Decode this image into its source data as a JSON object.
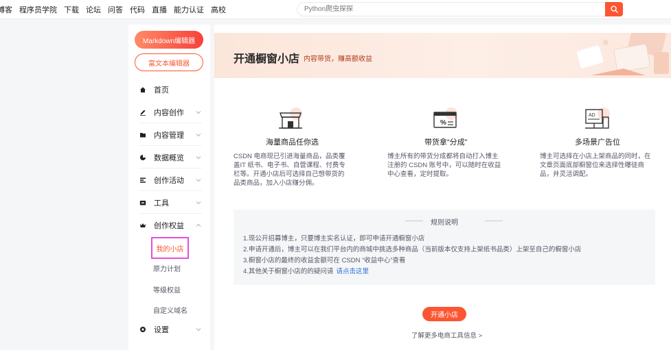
{
  "nav": {
    "items": [
      "博客",
      "程序员学院",
      "下载",
      "论坛",
      "问答",
      "代码",
      "直播",
      "能力认证",
      "高校"
    ]
  },
  "search": {
    "placeholder": "Python爬虫探探"
  },
  "sidebar": {
    "markdown_btn": "Markdown编辑器",
    "richtext_btn": "富文本编辑器",
    "items": [
      {
        "label": "首页",
        "icon": "home-icon"
      },
      {
        "label": "内容创作",
        "icon": "pen-icon"
      },
      {
        "label": "内容管理",
        "icon": "folder-icon"
      },
      {
        "label": "数据概览",
        "icon": "pie-chart-icon"
      },
      {
        "label": "创作活动",
        "icon": "list-icon"
      },
      {
        "label": "工具",
        "icon": "toolbox-icon"
      },
      {
        "label": "创作权益",
        "icon": "crown-icon"
      },
      {
        "label": "设置",
        "icon": "gear-icon"
      }
    ],
    "sub_items": [
      "我的小店",
      "原力计划",
      "等级权益",
      "自定义域名"
    ]
  },
  "banner": {
    "title": "开通橱窗小店",
    "subtitle": "内容带货，赚高额收益"
  },
  "features": [
    {
      "title": "海量商品任你选",
      "desc": "CSDN 电商现已引进海量商品，品类覆盖IT 纸书、电子书、自营课程、付费专栏等。开通小店后可选择自己想带货的品类商品，加入小店赚分佣。",
      "icon": "storefront-icon"
    },
    {
      "title": "带货拿“分成”",
      "desc": "博主所有的带货分成都将自动打入博主注册的 CSDN 账号中，可以随时在收益中心查看，定时提取。",
      "icon": "percent-card-icon"
    },
    {
      "title": "多场景广告位",
      "desc": "博主可选择在小店上架商品的同时，在文章页面底部橱窗位来选择性曝徒商品，并灵活调配。",
      "icon": "ad-screen-icon"
    }
  ],
  "rules": {
    "title": "规则说明",
    "items": [
      "1.现公开招募博主，只要博主实名认证，即可申请开通橱窗小店",
      "2.申请开通后，博主可以在我们平台内的商城中挑选多种商品（当前版本仅支持上架纸书品类）上架至自己的橱窗小店",
      "3.橱窗小店的最终的收益金额可在 CSDN “收益中心”查看",
      "4.其他关于橱窗小店的的疑问请"
    ],
    "link": "请点击这里"
  },
  "open_btn": "开通小店",
  "more_link": "了解更多电商工具信息 >",
  "colors": {
    "accent": "#fc5531",
    "highlight_border": "#e84dd8",
    "link": "#2d70d6"
  }
}
